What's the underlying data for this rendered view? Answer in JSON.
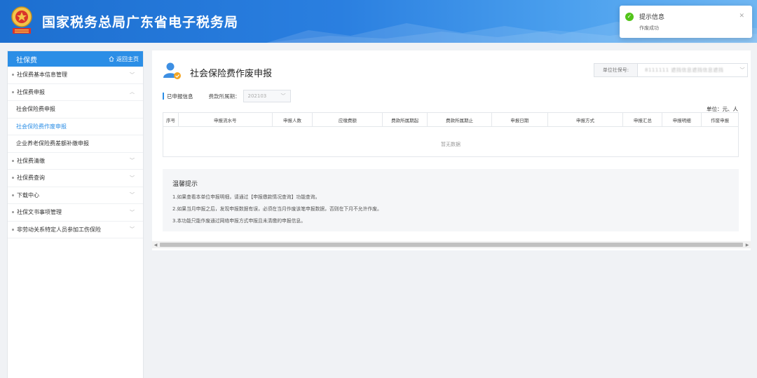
{
  "header": {
    "title": "国家税务总局广东省电子税务局"
  },
  "colors": {
    "accent": "#2b8ee6",
    "success": "#52c41a",
    "header": "#1d6fd0"
  },
  "sidebar": {
    "title": "社保费",
    "home_label": "返回主页",
    "items": [
      {
        "label": "社保费基本信息管理",
        "type": "group"
      },
      {
        "label": "社保费申报",
        "type": "group-open"
      },
      {
        "label": "社会保险费申报",
        "type": "sub"
      },
      {
        "label": "社会保险费作废申报",
        "type": "sub-active"
      },
      {
        "label": "企业养老保险费差额补缴申报",
        "type": "sub"
      },
      {
        "label": "社保费清缴",
        "type": "group"
      },
      {
        "label": "社保费查询",
        "type": "group"
      },
      {
        "label": "下载中心",
        "type": "group"
      },
      {
        "label": "社保文书事项管理",
        "type": "group"
      },
      {
        "label": "非劳动关系特定人员参加工伤保险",
        "type": "group"
      }
    ]
  },
  "main": {
    "title": "社会保险费作废申报",
    "unit_label": "单位社保号:",
    "unit_value": "8111111 遮挡信息遮挡信息遮挡",
    "tag": "已申报信息",
    "period_label": "费款所属期：",
    "period_value": "202103",
    "unit_note": "单位：元、人",
    "columns": [
      "序号",
      "申报流水号",
      "申报人数",
      "应缴费额",
      "费款所属期起",
      "费款所属期止",
      "申报日期",
      "申报方式",
      "申报汇总",
      "申报明细",
      "作废申报"
    ],
    "empty_text": "暂无数据",
    "tips": {
      "title": "温馨提示",
      "lines": [
        "1.如果查看本单位申报明细，请通过【申报缴款情况查询】功能查询。",
        "2.如果当月申报之后，发现申报数据有误，必须在当月作废该笔申报数据，否则在下月不允许作废。",
        "3.本功能只能作废通过网络申报方式申报且未清缴的申报信息。"
      ]
    }
  },
  "toast": {
    "title": "提示信息",
    "message": "作废成功",
    "icon": "check-circle-icon"
  }
}
